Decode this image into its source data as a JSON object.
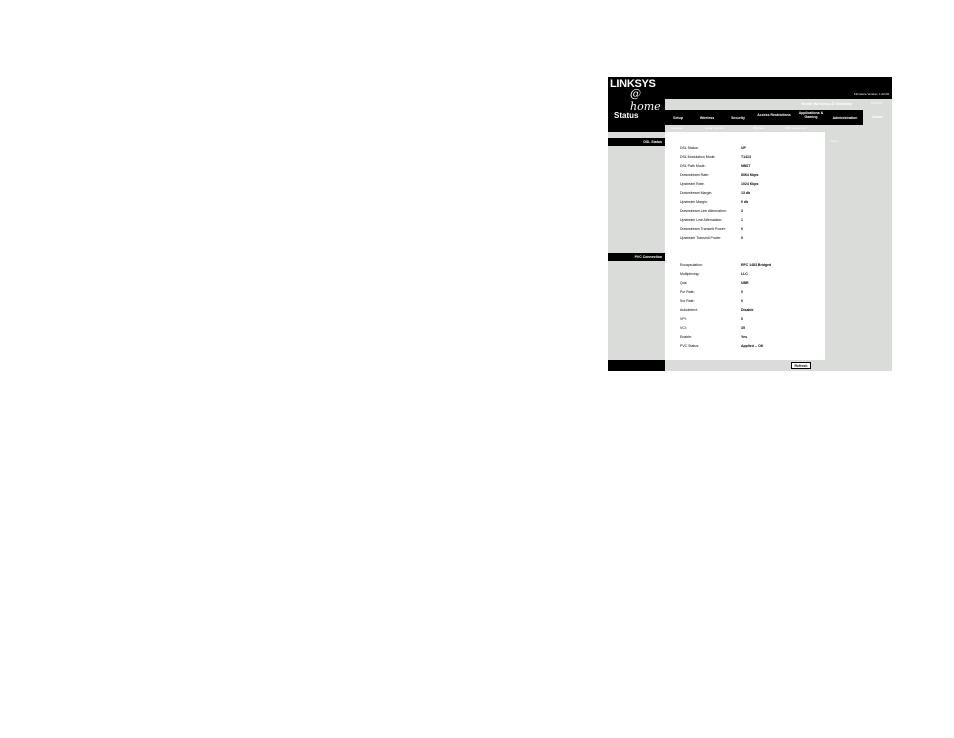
{
  "brand": {
    "logo_text": "LINKSYS",
    "logo_sub": "@ home"
  },
  "header": {
    "section_title": "Status",
    "firmware": "Firmware Version: 1.02.00",
    "product_name": "Home Wireless-G Gateway",
    "model": "HG200"
  },
  "tabs": [
    {
      "label": "Setup"
    },
    {
      "label": "Wireless"
    },
    {
      "label": "Security"
    },
    {
      "label": "Access Restrictions"
    },
    {
      "label": "Applications & Gaming"
    },
    {
      "label": "Administration"
    },
    {
      "label": "Status"
    }
  ],
  "subtabs": [
    {
      "label": "Gateway"
    },
    {
      "label": "Local Network"
    },
    {
      "label": "Wireless"
    },
    {
      "label": "DSL Connection"
    }
  ],
  "dsl": {
    "section_label": "DSL Status",
    "rows": [
      {
        "label": "DSL Status:",
        "value": "UP"
      },
      {
        "label": "DSL Modulation Mode:",
        "value": "T1413"
      },
      {
        "label": "DSL Path Mode:",
        "value": "NBST"
      },
      {
        "label": "Downstream Rate:",
        "value": "8064 Kbps"
      },
      {
        "label": "Upstream Rate:",
        "value": "1024 Kbps"
      },
      {
        "label": "Downstream Margin:",
        "value": "13 db"
      },
      {
        "label": "Upstream Margin:",
        "value": "0 db"
      },
      {
        "label": "Downstream Line Attenuation:",
        "value": "3"
      },
      {
        "label": "Upstream Line Attenuation:",
        "value": "1"
      },
      {
        "label": "Downstream Transmit Power:",
        "value": "0"
      },
      {
        "label": "Upstream Transmit Power:",
        "value": "0"
      }
    ]
  },
  "pvc": {
    "section_label": "PVC Connection",
    "rows": [
      {
        "label": "Encapsulation:",
        "value": "RFC 1483 Bridged"
      },
      {
        "label": "Multiplexing:",
        "value": "LLC"
      },
      {
        "label": "Qos:",
        "value": "UBR"
      },
      {
        "label": "Pcr Rate:",
        "value": "0"
      },
      {
        "label": "Scr Rate:",
        "value": "0"
      },
      {
        "label": "Autodetect:",
        "value": "Disable"
      },
      {
        "label": "VPI:",
        "value": "0"
      },
      {
        "label": "VCI:",
        "value": "35"
      },
      {
        "label": "Enable:",
        "value": "Yes"
      },
      {
        "label": "PVC Status:",
        "value": "Applied -- OK"
      }
    ]
  },
  "help": {
    "title": "More..."
  },
  "buttons": {
    "refresh": "Refresh"
  }
}
